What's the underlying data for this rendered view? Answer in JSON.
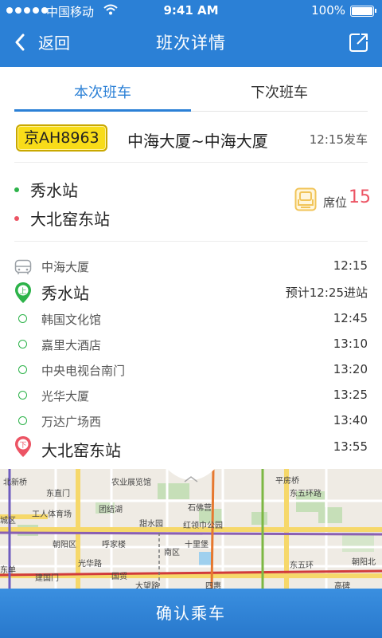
{
  "status_bar": {
    "carrier": "中国移动",
    "time": "9:41 AM",
    "battery": "100%"
  },
  "header": {
    "back_label": "返回",
    "title": "班次详情"
  },
  "tabs": [
    {
      "label": "本次班车",
      "active": true
    },
    {
      "label": "下次班车",
      "active": false
    }
  ],
  "trip": {
    "plate": "京AH8963",
    "route": "中海大厦~中海大厦",
    "depart": "12:15发车",
    "board_stop": "秀水站",
    "alight_stop": "大北窑东站",
    "seat_label": "席位",
    "seat_number": "15"
  },
  "timeline": [
    {
      "name": "中海大厦",
      "time": "12:15",
      "kind": "bus"
    },
    {
      "name": "秀水站",
      "time": "预计12:25进站",
      "kind": "board"
    },
    {
      "name": "韩国文化馆",
      "time": "12:45",
      "kind": "stop"
    },
    {
      "name": "嘉里大酒店",
      "time": "13:10",
      "kind": "stop"
    },
    {
      "name": "中央电视台南门",
      "time": "13:20",
      "kind": "stop"
    },
    {
      "name": "光华大厦",
      "time": "13:25",
      "kind": "stop"
    },
    {
      "name": "万达广场西",
      "time": "13:40",
      "kind": "stop"
    },
    {
      "name": "大北窑东站",
      "time": "13:55",
      "kind": "alight"
    }
  ],
  "map_labels": {
    "l1": "北新桥",
    "l2": "农业展览馆",
    "l3": "平房桥",
    "l4": "东直门",
    "l5": "团结湖",
    "l6": "石佛营",
    "l7": "工人体育场",
    "l8": "甜水园",
    "l9": "红领巾公园",
    "l10": "东五环路",
    "l11": "城区",
    "l12": "朝阳区",
    "l13": "呼家楼",
    "l14": "十里堡",
    "l15": "南区",
    "l16": "光华路",
    "l17": "东单",
    "l18": "建国门",
    "l19": "国贸",
    "l20": "大望路",
    "l21": "朝阳北",
    "l22": "四惠",
    "l23": "东五环",
    "l24": "高碑"
  },
  "confirm_label": "确认乘车",
  "colors": {
    "primary": "#2b80d6",
    "plate": "#f8dc19",
    "seat": "#ec5464",
    "board": "#2db34a",
    "alight": "#ec5464"
  }
}
